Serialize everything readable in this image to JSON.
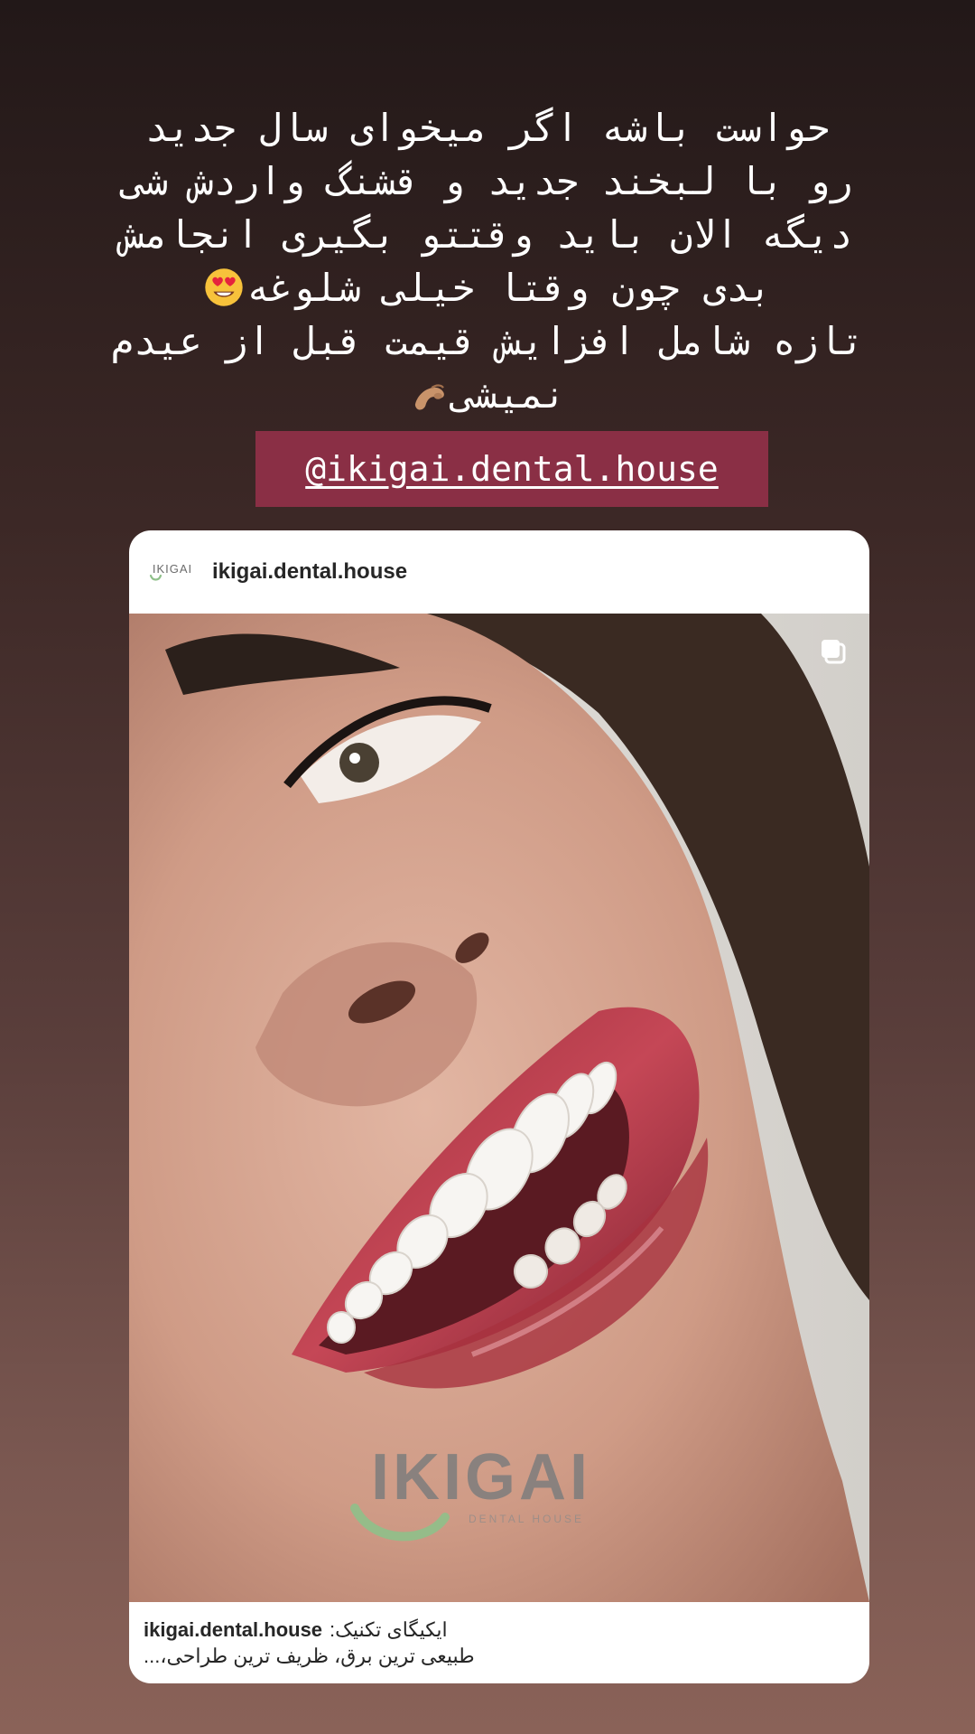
{
  "story": {
    "text_lines": [
      "حواست باشه اگر میخوای سال جدید",
      "رو با لبخند جدید و قشنگ واردش شی",
      "دیگه الان باید وقتتو بگیری انجامش",
      "بدی چون وقتا خیلی شلوغه",
      "تازه شامل افزایش قیمت قبل از عیدم",
      "نمیشی"
    ],
    "mention": "@ikigai.dental.house"
  },
  "post": {
    "avatar_logo": "IKIGAI",
    "username": "ikigai.dental.house",
    "image_watermark": "IKIGAI",
    "image_watermark_sub": "DENTAL HOUSE",
    "caption_user": "ikigai.dental.house",
    "caption_line1": "ایکیگای تکنیک:",
    "caption_line2": "طبیعی ترین برق، ظریف ترین طراحی،..."
  },
  "icons": {
    "emoji_1": "heart-eyes-emoji-icon",
    "emoji_2": "pinched-fingers-emoji-icon",
    "carousel": "carousel-icon"
  },
  "colors": {
    "mention_bg": "#8a2f45",
    "card_bg": "#ffffff",
    "logo_green": "#8fc08a",
    "logo_gray": "#6b6b6b"
  }
}
